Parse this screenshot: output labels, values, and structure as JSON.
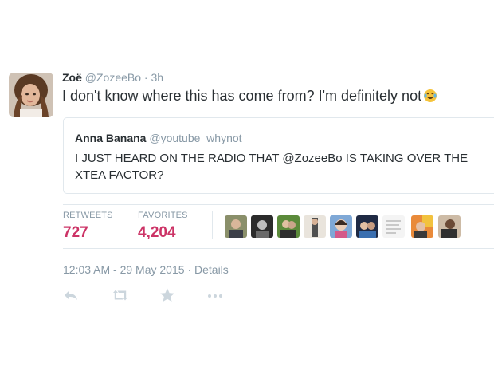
{
  "tweet": {
    "display_name": "Zoë",
    "handle": "@ZozeeBo",
    "separator": "·",
    "age": "3h",
    "text": "I don't know where this has come from? I'm definitely not"
  },
  "quoted": {
    "display_name": "Anna Banana",
    "handle": "@youtube_whynot",
    "text": "I JUST HEARD ON THE RADIO THAT @ZozeeBo IS TAKING OVER THE XTEA FACTOR?"
  },
  "stats": {
    "retweets_label": "RETWEETS",
    "retweets_value": "727",
    "favorites_label": "FAVORITES",
    "favorites_value": "4,204"
  },
  "favoriters": [
    {
      "icon": "user-avatar"
    },
    {
      "icon": "user-avatar"
    },
    {
      "icon": "user-avatar"
    },
    {
      "icon": "user-avatar"
    },
    {
      "icon": "user-avatar"
    },
    {
      "icon": "user-avatar"
    },
    {
      "icon": "user-avatar"
    },
    {
      "icon": "user-avatar"
    },
    {
      "icon": "user-avatar"
    }
  ],
  "footer": {
    "timestamp": "12:03 AM - 29 May 2015",
    "separator": "·",
    "details_label": "Details"
  },
  "actions": [
    "reply-icon",
    "retweet-icon",
    "favorite-icon",
    "more-icon"
  ],
  "colors": {
    "accent": "#cc3366",
    "muted": "#8899a6",
    "border": "#e1e8ed",
    "text": "#292f33"
  }
}
